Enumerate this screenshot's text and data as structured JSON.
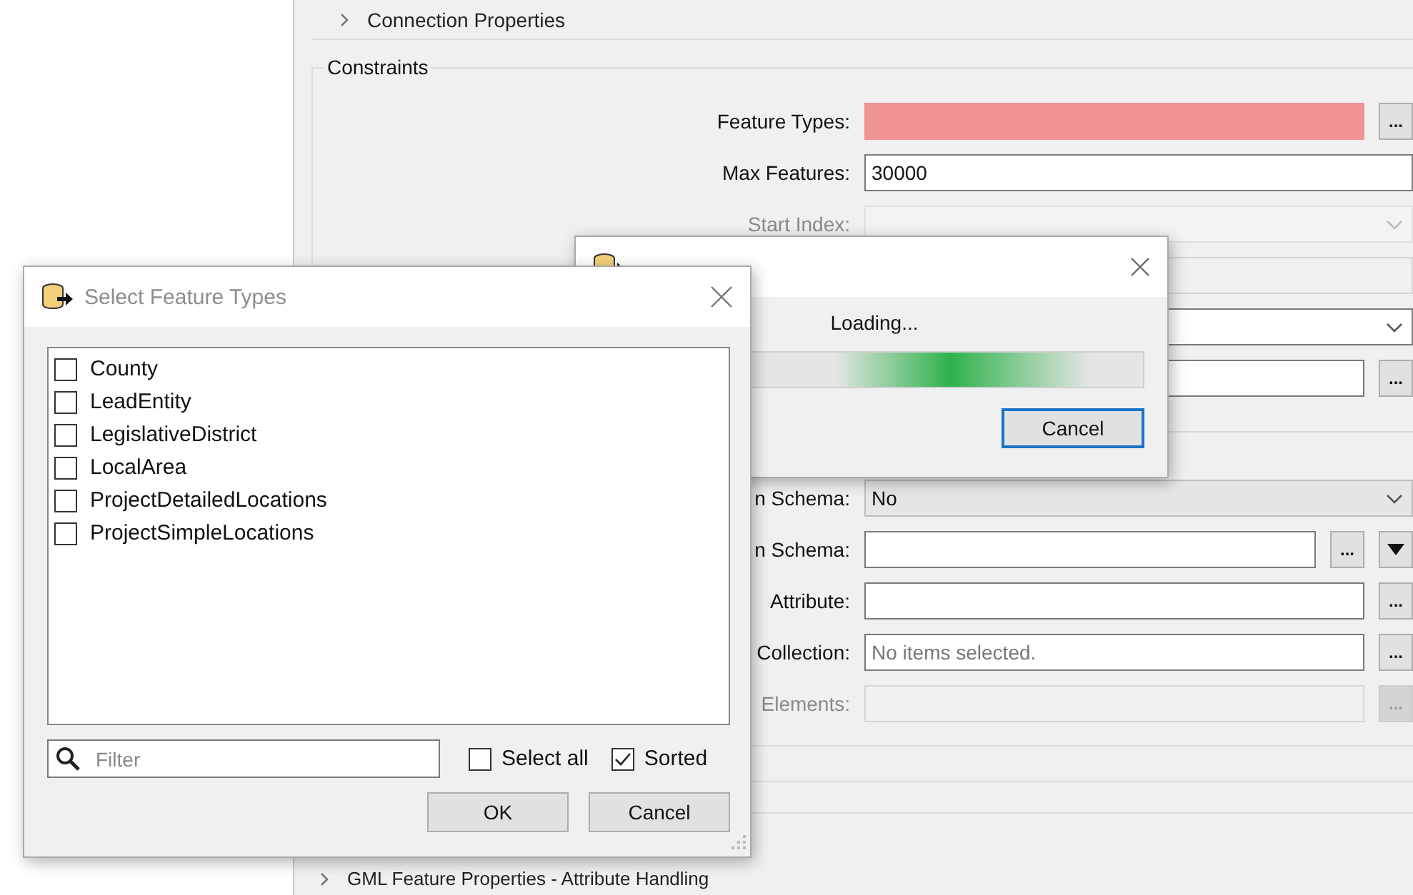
{
  "settings_panel": {
    "top_section": {
      "label": "Connection Properties"
    },
    "group": {
      "title": "Constraints",
      "rows": [
        {
          "kind": "field",
          "label": "Feature Types:",
          "invalid": true,
          "disabled": false,
          "buttons": [
            "..."
          ]
        },
        {
          "kind": "field",
          "label": "Max Features:",
          "value": "30000",
          "invalid": false,
          "disabled": false
        },
        {
          "kind": "combo",
          "label": "Start Index:",
          "disabled": true
        },
        {
          "kind": "field",
          "invalid": false,
          "disabled": true
        },
        {
          "kind": "combo",
          "disabled": false
        },
        {
          "kind": "field",
          "invalid": false,
          "disabled": false,
          "buttons": [
            "..."
          ]
        },
        {
          "kind": "divider"
        },
        {
          "kind": "combo",
          "label": "n Schema:",
          "value": "No",
          "disabled": false
        },
        {
          "kind": "field",
          "label": "n Schema:",
          "invalid": false,
          "disabled": false,
          "buttons": [
            "..."
          ],
          "dropdown_button": true
        },
        {
          "kind": "field",
          "label": "Attribute:",
          "invalid": false,
          "disabled": false,
          "buttons": [
            "..."
          ]
        },
        {
          "kind": "field",
          "label": "Collection:",
          "placeholder": "No items selected.",
          "invalid": false,
          "disabled": false,
          "buttons": [
            "..."
          ]
        },
        {
          "kind": "field",
          "label": "Elements:",
          "invalid": false,
          "disabled": true,
          "buttons": [
            "..."
          ]
        }
      ]
    },
    "bottom_section": {
      "label": "GML Feature Properties - Attribute Handling"
    }
  },
  "loading_dialog": {
    "message": "Loading...",
    "cancel": "Cancel"
  },
  "select_dialog": {
    "title": "Select Feature Types",
    "items": [
      {
        "label": "County",
        "checked": false
      },
      {
        "label": "LeadEntity",
        "checked": false
      },
      {
        "label": "LegislativeDistrict",
        "checked": false
      },
      {
        "label": "LocalArea",
        "checked": false
      },
      {
        "label": "ProjectDetailedLocations",
        "checked": false
      },
      {
        "label": "ProjectSimpleLocations",
        "checked": false
      }
    ],
    "filter": {
      "placeholder": "Filter"
    },
    "select_all": {
      "label": "Select all",
      "checked": false
    },
    "sorted": {
      "label": "Sorted",
      "checked": true
    },
    "buttons": [
      "OK",
      "Cancel"
    ]
  }
}
